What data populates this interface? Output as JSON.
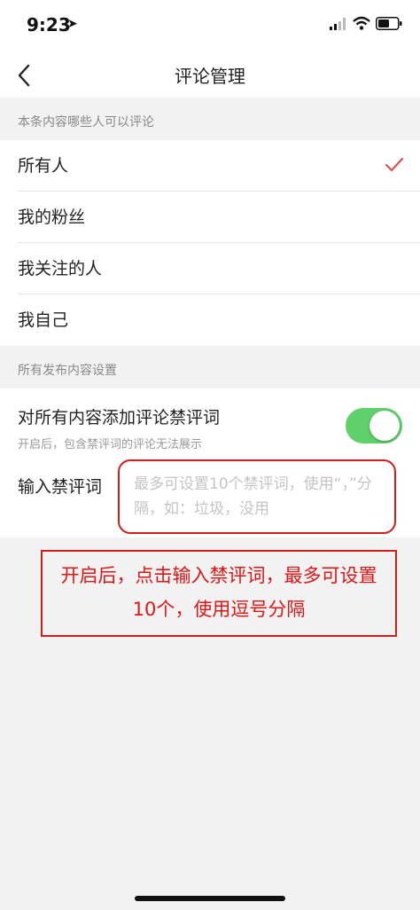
{
  "status_bar": {
    "time": "9:23"
  },
  "nav": {
    "title": "评论管理"
  },
  "comment_scope": {
    "header": "本条内容哪些人可以评论",
    "options": [
      {
        "label": "所有人",
        "selected": true
      },
      {
        "label": "我的粉丝",
        "selected": false
      },
      {
        "label": "我关注的人",
        "selected": false
      },
      {
        "label": "我自己",
        "selected": false
      }
    ]
  },
  "publish_settings": {
    "header": "所有发布内容设置",
    "toggle_title": "对所有内容添加评论禁评词",
    "toggle_desc": "开启后，包含禁评词的评论无法展示",
    "toggle_on": true,
    "banned_label": "输入禁评词",
    "banned_placeholder": "最多可设置10个禁评词，使用“，”分隔，如：垃圾，没用",
    "banned_value": ""
  },
  "annotation": {
    "text": "开启后，点击输入禁评词，最多可设置10个，使用逗号分隔"
  },
  "colors": {
    "accent_check": "#e05050",
    "toggle_on": "#5fd16a",
    "annotation_red": "#d21d1d"
  }
}
